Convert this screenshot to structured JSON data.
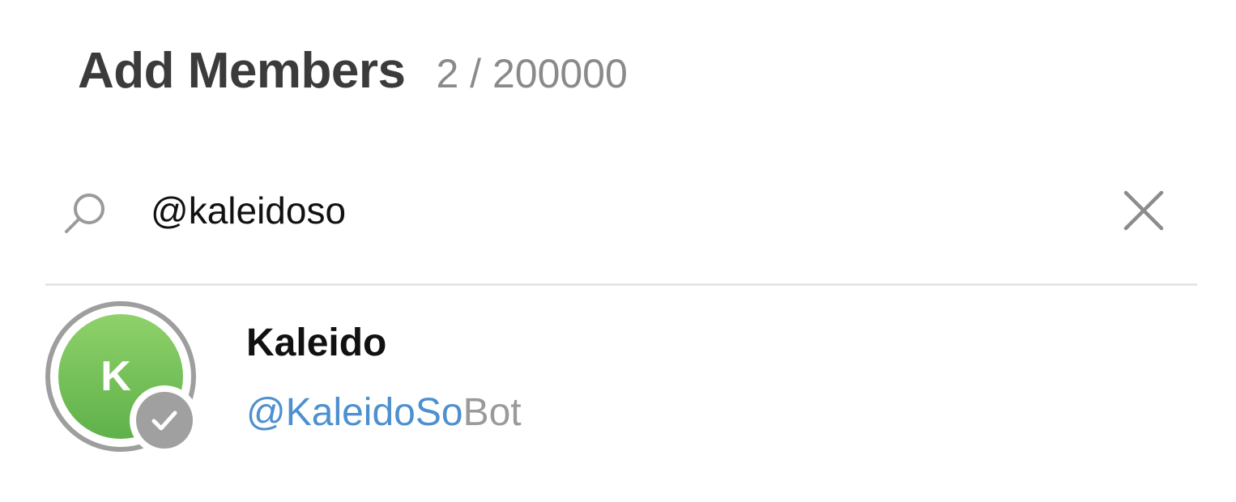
{
  "dialog": {
    "title": "Add Members",
    "count": "2 / 200000"
  },
  "search": {
    "value": "@kaleidoso",
    "placeholder": "",
    "icon": "search-icon",
    "clear_icon": "close-icon"
  },
  "results": [
    {
      "name": "Kaleido",
      "avatar_letter": "K",
      "avatar_color": "#6cc04a",
      "username_match": "@KaleidoSo",
      "username_rest": "Bot",
      "selected": true
    }
  ],
  "colors": {
    "link": "#4e90cf",
    "muted": "#9a9a9a",
    "title": "#3b3b3b"
  }
}
